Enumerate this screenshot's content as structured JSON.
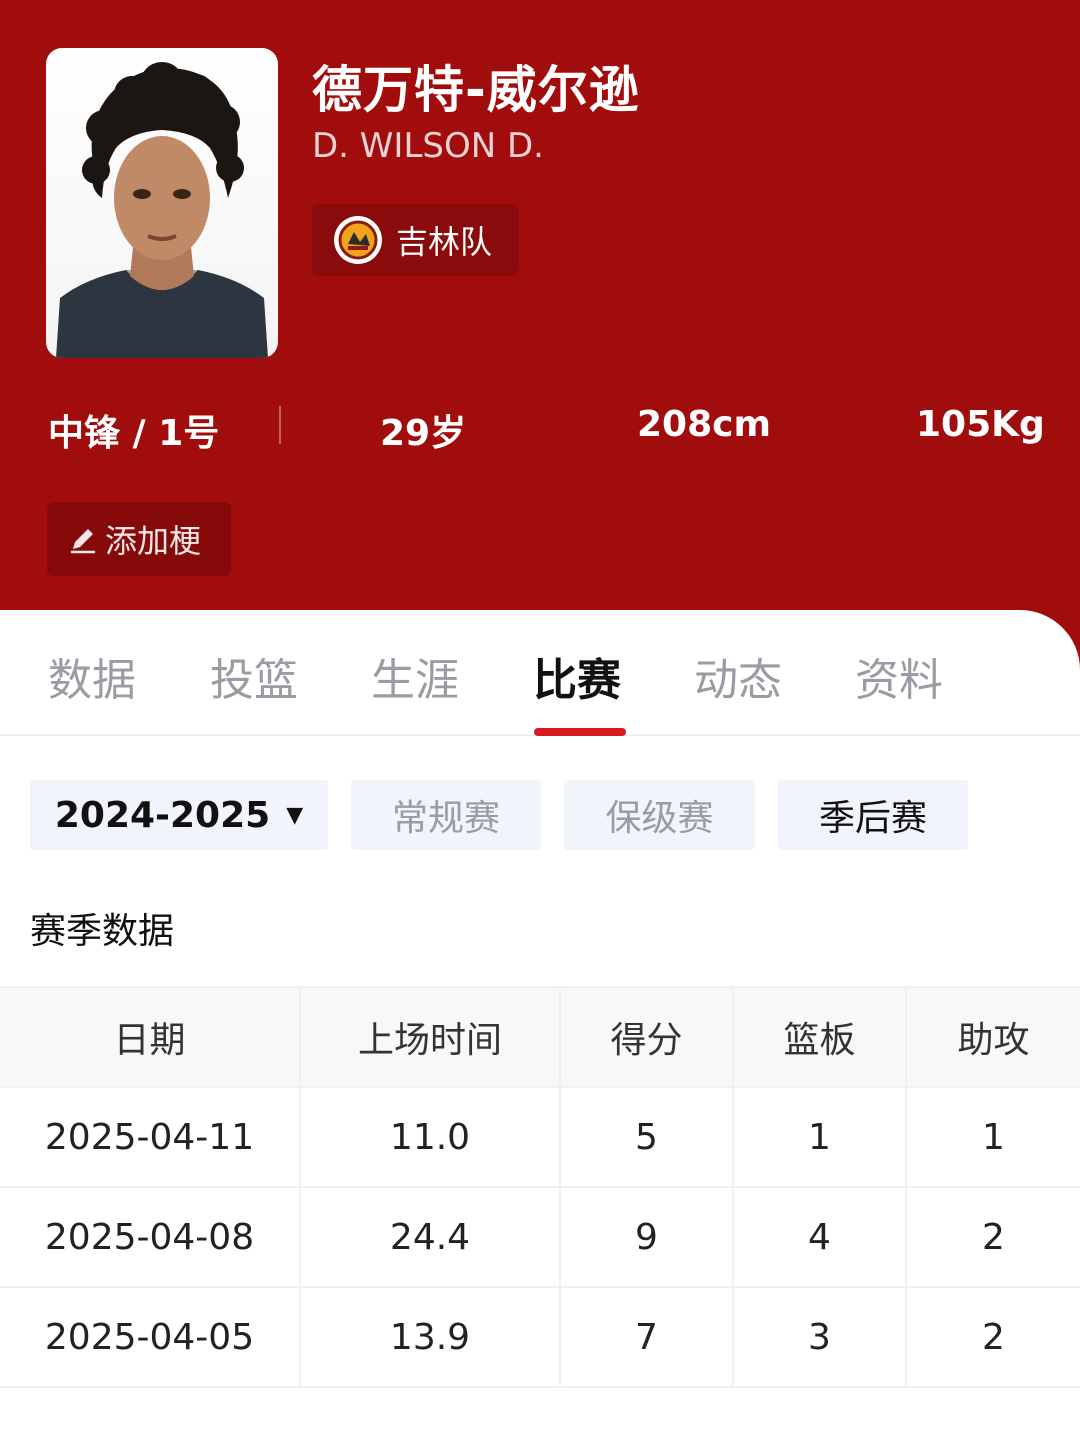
{
  "player": {
    "name_cn": "德万特-威尔逊",
    "name_en": "D. WILSON D.",
    "team": "吉林队"
  },
  "stats": {
    "position_number": "中锋 / 1号",
    "age": "29岁",
    "height": "208cm",
    "weight": "105Kg"
  },
  "add_button": {
    "label": "添加梗"
  },
  "tabs": [
    {
      "label": "数据",
      "active": false
    },
    {
      "label": "投篮",
      "active": false
    },
    {
      "label": "生涯",
      "active": false
    },
    {
      "label": "比赛",
      "active": true
    },
    {
      "label": "动态",
      "active": false
    },
    {
      "label": "资料",
      "active": false
    }
  ],
  "filters": {
    "season": "2024-2025",
    "options": [
      "常规赛",
      "保级赛",
      "季后赛"
    ],
    "selected": "季后赛"
  },
  "section_title": "赛季数据",
  "table": {
    "headers": [
      "日期",
      "上场时间",
      "得分",
      "篮板",
      "助攻"
    ],
    "rows": [
      [
        "2025-04-11",
        "11.0",
        "5",
        "1",
        "1"
      ],
      [
        "2025-04-08",
        "24.4",
        "9",
        "4",
        "2"
      ],
      [
        "2025-04-05",
        "13.9",
        "7",
        "3",
        "2"
      ]
    ]
  },
  "colors": {
    "header_bg": "#a10d0d",
    "accent": "#d71921"
  }
}
